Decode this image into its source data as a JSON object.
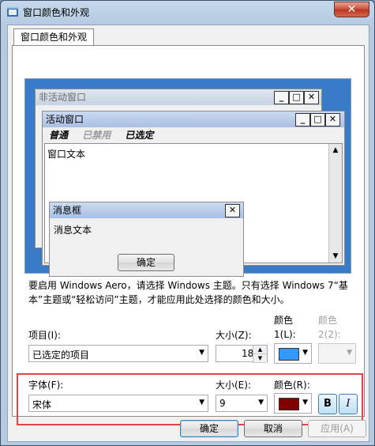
{
  "window": {
    "title": "窗口颜色和外观",
    "close_glyph": "✕"
  },
  "tab": {
    "label": "窗口颜色和外观"
  },
  "preview": {
    "inactive_window_title": "非活动窗口",
    "active_window_title": "活动窗口",
    "menu": {
      "normal": "普通",
      "disabled": "已禁用",
      "selected": "已选定"
    },
    "window_text": "窗口文本",
    "message_box_title": "消息框",
    "message_text": "消息文本",
    "ok_button": "确定",
    "minimize_glyph": "_",
    "maximize_glyph": "□",
    "close_glyph": "✕",
    "scroll_up_glyph": "▲",
    "scroll_down_glyph": "▼"
  },
  "note": "要启用 Windows Aero，请选择 Windows 主题。只有选择 Windows 7“基本”主题或“轻松访问”主题，才能应用此处选择的颜色和大小。",
  "item": {
    "label": "项目(I):",
    "value": "已选定的项目",
    "size_label": "大小(Z):",
    "size_value": "18",
    "color1_label_a": "颜色",
    "color1_label_b": "1(L):",
    "color1_hex": "#3399ff",
    "color2_label_a": "颜色",
    "color2_label_b": "2(2):"
  },
  "font": {
    "label": "字体(F):",
    "value": "宋体",
    "size_label": "大小(E):",
    "size_value": "9",
    "color_label": "颜色(R):",
    "color_hex": "#800000",
    "bold_label": "B",
    "italic_label": "I"
  },
  "buttons": {
    "ok": "确定",
    "cancel": "取消",
    "apply": "应用(A)"
  },
  "glyphs": {
    "dropdown": "▼",
    "spin_up": "▲",
    "spin_down": "▼"
  }
}
